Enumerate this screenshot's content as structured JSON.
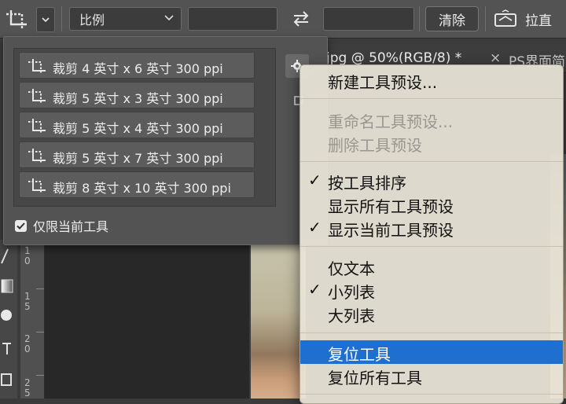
{
  "options_bar": {
    "ratio_label": "比例",
    "width_value": "",
    "height_value": "",
    "clear_label": "清除",
    "straighten_label": "拉直"
  },
  "document_tab": {
    "title": "jpg @ 50%(RGB/8) *",
    "close_glyph": "×",
    "second_title": "PS界面简"
  },
  "rulers": {
    "labels": [
      {
        "d1": "1",
        "d2": "0"
      },
      {
        "d1": "1",
        "d2": "5"
      },
      {
        "d1": "2",
        "d2": "0"
      },
      {
        "d1": "2",
        "d2": "5"
      }
    ]
  },
  "presets": {
    "items": [
      {
        "label": "裁剪 4 英寸 x 6 英寸 300 ppi"
      },
      {
        "label": "裁剪 5 英寸 x 3 英寸 300 ppi"
      },
      {
        "label": "裁剪 5 英寸 x 4 英寸 300 ppi"
      },
      {
        "label": "裁剪 5 英寸 x 7 英寸 300 ppi"
      },
      {
        "label": "裁剪 8 英寸 x 10 英寸 300 ppi"
      }
    ],
    "only_current_label": "仅限当前工具",
    "only_current_checked": true
  },
  "menu": {
    "items": [
      {
        "label": "新建工具预设...",
        "checked": false,
        "enabled": true
      },
      {
        "label": "重命名工具预设...",
        "checked": false,
        "enabled": false
      },
      {
        "label": "删除工具预设",
        "checked": false,
        "enabled": false
      },
      {
        "label": "按工具排序",
        "checked": true,
        "enabled": true
      },
      {
        "label": "显示所有工具预设",
        "checked": false,
        "enabled": true
      },
      {
        "label": "显示当前工具预设",
        "checked": true,
        "enabled": true
      },
      {
        "label": "仅文本",
        "checked": false,
        "enabled": true
      },
      {
        "label": "小列表",
        "checked": true,
        "enabled": true
      },
      {
        "label": "大列表",
        "checked": false,
        "enabled": true
      },
      {
        "label": "复位工具",
        "checked": false,
        "enabled": true,
        "highlighted": true
      },
      {
        "label": "复位所有工具",
        "checked": false,
        "enabled": true
      }
    ],
    "check_glyph": "✓"
  },
  "colors": {
    "highlight": "#1f6fd0",
    "menu_bg": "#e8e3d6",
    "panel_bg": "#535353"
  }
}
